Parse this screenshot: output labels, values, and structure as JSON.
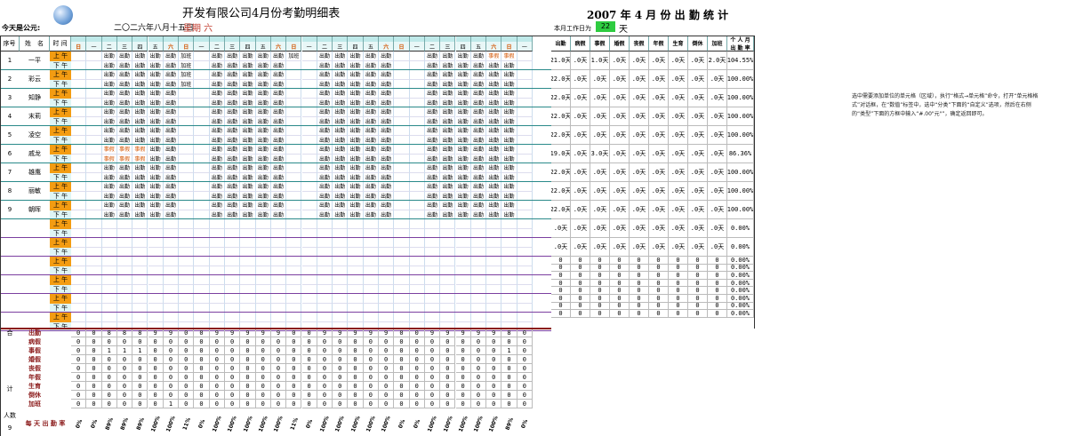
{
  "header": {
    "title": "开发有限公司4月份考勤明细表",
    "right_title": "2007 年 4 月 份 出 勤 统 计",
    "today_label": "今天是公元:",
    "date_text": "二〇二六年八月十五日",
    "weekday": "星期 六",
    "workdays_label": "本月工作日为",
    "workdays_value": "22",
    "workdays_unit": "天"
  },
  "table": {
    "col_headers": [
      "序号",
      "姓　名",
      "时 间"
    ],
    "week_labels": [
      "日",
      "一",
      "二",
      "三",
      "四",
      "五",
      "六",
      "日",
      "一",
      "二",
      "三",
      "四",
      "五",
      "六",
      "日",
      "一",
      "二",
      "三",
      "四",
      "五",
      "六",
      "日",
      "一",
      "二",
      "三",
      "四",
      "五",
      "六",
      "日",
      "一"
    ],
    "am": "上 午",
    "pm": "下 午",
    "employees": [
      {
        "no": "1",
        "name": "一平"
      },
      {
        "no": "2",
        "name": "彩云"
      },
      {
        "no": "3",
        "name": "知静"
      },
      {
        "no": "4",
        "name": "末莉"
      },
      {
        "no": "5",
        "name": "凌空"
      },
      {
        "no": "6",
        "name": "戚龙"
      },
      {
        "no": "7",
        "name": "雄鹰"
      },
      {
        "no": "8",
        "name": "丽敏"
      },
      {
        "no": "9",
        "name": "朝晖"
      },
      {
        "no": "",
        "name": ""
      },
      {
        "no": "",
        "name": ""
      },
      {
        "no": "",
        "name": ""
      },
      {
        "no": "",
        "name": ""
      },
      {
        "no": "",
        "name": ""
      },
      {
        "no": "",
        "name": ""
      }
    ],
    "marks": {
      "attend": "出勤",
      "overtime": "加班",
      "leave": "事假"
    }
  },
  "stats": {
    "headers": [
      "出勤",
      "病假",
      "事假",
      "婚假",
      "丧假",
      "年假",
      "生育",
      "倒休",
      "加班",
      "个 人 月 出 勤 率"
    ],
    "rows": [
      [
        "21.0天",
        ".0天",
        "1.0天",
        ".0天",
        ".0天",
        ".0天",
        ".0天",
        ".0天",
        "2.0天",
        "104.55%"
      ],
      [
        "22.0天",
        ".0天",
        ".0天",
        ".0天",
        ".0天",
        ".0天",
        ".0天",
        ".0天",
        ".0天",
        "100.00%"
      ],
      [
        "22.0天",
        ".0天",
        ".0天",
        ".0天",
        ".0天",
        ".0天",
        ".0天",
        ".0天",
        ".0天",
        "100.00%"
      ],
      [
        "22.0天",
        ".0天",
        ".0天",
        ".0天",
        ".0天",
        ".0天",
        ".0天",
        ".0天",
        ".0天",
        "100.00%"
      ],
      [
        "22.0天",
        ".0天",
        ".0天",
        ".0天",
        ".0天",
        ".0天",
        ".0天",
        ".0天",
        ".0天",
        "100.00%"
      ],
      [
        "19.0天",
        ".0天",
        "3.0天",
        ".0天",
        ".0天",
        ".0天",
        ".0天",
        ".0天",
        ".0天",
        "86.36%"
      ],
      [
        "22.0天",
        ".0天",
        ".0天",
        ".0天",
        ".0天",
        ".0天",
        ".0天",
        ".0天",
        ".0天",
        "100.00%"
      ],
      [
        "22.0天",
        ".0天",
        ".0天",
        ".0天",
        ".0天",
        ".0天",
        ".0天",
        ".0天",
        ".0天",
        "100.00%"
      ],
      [
        "22.0天",
        ".0天",
        ".0天",
        ".0天",
        ".0天",
        ".0天",
        ".0天",
        ".0天",
        ".0天",
        "100.00%"
      ],
      [
        ".0天",
        ".0天",
        ".0天",
        ".0天",
        ".0天",
        ".0天",
        ".0天",
        ".0天",
        ".0天",
        "0.00%"
      ],
      [
        ".0天",
        ".0天",
        ".0天",
        ".0天",
        ".0天",
        ".0天",
        ".0天",
        ".0天",
        ".0天",
        "0.00%"
      ]
    ],
    "zero_rows": [
      [
        "0",
        "0",
        "0",
        "0",
        "0",
        "0",
        "0",
        "0",
        "0",
        "0.00%"
      ],
      [
        "0",
        "0",
        "0",
        "0",
        "0",
        "0",
        "0",
        "0",
        "0",
        "0.00%"
      ],
      [
        "0",
        "0",
        "0",
        "0",
        "0",
        "0",
        "0",
        "0",
        "0",
        "0.00%"
      ],
      [
        "0",
        "0",
        "0",
        "0",
        "0",
        "0",
        "0",
        "0",
        "0",
        "0.00%"
      ],
      [
        "0",
        "0",
        "0",
        "0",
        "0",
        "0",
        "0",
        "0",
        "0",
        "0.00%"
      ],
      [
        "0",
        "0",
        "0",
        "0",
        "0",
        "0",
        "0",
        "0",
        "0",
        "0.00%"
      ],
      [
        "0",
        "0",
        "0",
        "0",
        "0",
        "0",
        "0",
        "0",
        "0",
        "0.00%"
      ],
      [
        "0",
        "0",
        "0",
        "0",
        "0",
        "0",
        "0",
        "0",
        "0",
        "0.00%"
      ]
    ]
  },
  "summary": {
    "side_labels": [
      "合",
      "计"
    ],
    "labels": [
      "出勤",
      "病假",
      "事假",
      "婚假",
      "丧假",
      "年假",
      "生育",
      "倒休",
      "加班"
    ],
    "rows": [
      [
        "0",
        "0",
        "8",
        "8",
        "8",
        "9",
        "9",
        "0",
        "0",
        "9",
        "9",
        "9",
        "9",
        "9",
        "0",
        "0",
        "9",
        "9",
        "9",
        "9",
        "9",
        "0",
        "0",
        "9",
        "9",
        "9",
        "9",
        "9",
        "8",
        "0"
      ],
      [
        "0",
        "0",
        "0",
        "0",
        "0",
        "0",
        "0",
        "0",
        "0",
        "0",
        "0",
        "0",
        "0",
        "0",
        "0",
        "0",
        "0",
        "0",
        "0",
        "0",
        "0",
        "0",
        "0",
        "0",
        "0",
        "0",
        "0",
        "0",
        "0",
        "0"
      ],
      [
        "0",
        "0",
        "1",
        "1",
        "1",
        "0",
        "0",
        "0",
        "0",
        "0",
        "0",
        "0",
        "0",
        "0",
        "0",
        "0",
        "0",
        "0",
        "0",
        "0",
        "0",
        "0",
        "0",
        "0",
        "0",
        "0",
        "0",
        "0",
        "1",
        "0"
      ],
      [
        "0",
        "0",
        "0",
        "0",
        "0",
        "0",
        "0",
        "0",
        "0",
        "0",
        "0",
        "0",
        "0",
        "0",
        "0",
        "0",
        "0",
        "0",
        "0",
        "0",
        "0",
        "0",
        "0",
        "0",
        "0",
        "0",
        "0",
        "0",
        "0",
        "0"
      ],
      [
        "0",
        "0",
        "0",
        "0",
        "0",
        "0",
        "0",
        "0",
        "0",
        "0",
        "0",
        "0",
        "0",
        "0",
        "0",
        "0",
        "0",
        "0",
        "0",
        "0",
        "0",
        "0",
        "0",
        "0",
        "0",
        "0",
        "0",
        "0",
        "0",
        "0"
      ],
      [
        "0",
        "0",
        "0",
        "0",
        "0",
        "0",
        "0",
        "0",
        "0",
        "0",
        "0",
        "0",
        "0",
        "0",
        "0",
        "0",
        "0",
        "0",
        "0",
        "0",
        "0",
        "0",
        "0",
        "0",
        "0",
        "0",
        "0",
        "0",
        "0",
        "0"
      ],
      [
        "0",
        "0",
        "0",
        "0",
        "0",
        "0",
        "0",
        "0",
        "0",
        "0",
        "0",
        "0",
        "0",
        "0",
        "0",
        "0",
        "0",
        "0",
        "0",
        "0",
        "0",
        "0",
        "0",
        "0",
        "0",
        "0",
        "0",
        "0",
        "0",
        "0"
      ],
      [
        "0",
        "0",
        "0",
        "0",
        "0",
        "0",
        "0",
        "0",
        "0",
        "0",
        "0",
        "0",
        "0",
        "0",
        "0",
        "0",
        "0",
        "0",
        "0",
        "0",
        "0",
        "0",
        "0",
        "0",
        "0",
        "0",
        "0",
        "0",
        "0",
        "0"
      ],
      [
        "0",
        "0",
        "0",
        "0",
        "0",
        "0",
        "1",
        "0",
        "0",
        "0",
        "0",
        "0",
        "0",
        "0",
        "0",
        "0",
        "0",
        "0",
        "0",
        "0",
        "0",
        "0",
        "0",
        "0",
        "0",
        "0",
        "0",
        "0",
        "0",
        "0"
      ]
    ],
    "headcount_label": "人数",
    "headcount_value": "9",
    "rate_label": "每 天 出 勤 率",
    "rates": [
      "0%",
      "0%",
      "89%",
      "89%",
      "89%",
      "100%",
      "100%",
      "11%",
      "0%",
      "100%",
      "100%",
      "100%",
      "100%",
      "100%",
      "11%",
      "0%",
      "100%",
      "100%",
      "100%",
      "100%",
      "100%",
      "0%",
      "0%",
      "100%",
      "100%",
      "100%",
      "100%",
      "100%",
      "89%",
      "0%"
    ]
  },
  "note": "选中需要添加单位的单元格（区域），执行“格式→单元格”命令，打开“单元格格式”对话框，在“数值”标签中，选中“分类”下面的“自定义”选项，然后在右侧的“类型”下面的方框中输入“#.00\"元\"”，确定返回即可。",
  "colors": {
    "am": "#f39c12",
    "workdays": "#2ecc40",
    "header_teal": "#bfe9e9",
    "weekend": "#d35400"
  }
}
